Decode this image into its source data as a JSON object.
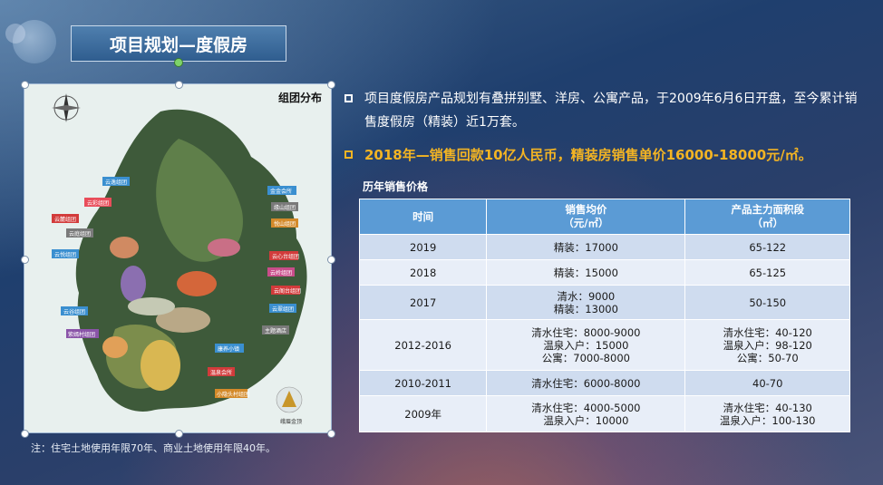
{
  "title": "项目规划—度假房",
  "map": {
    "caption": "组团分布",
    "labels": [
      "云逸组团",
      "云彩组团",
      "云庭组团",
      "云麓组团",
      "云悦组团",
      "云谷组团",
      "紫嫣村组团",
      "金金会所",
      "缘山组团",
      "悦山组团",
      "云心台组团",
      "云岭组团",
      "云阁台组团",
      "云翠组团",
      "主题酒店",
      "康养小镇",
      "温泉会所",
      "小隐头村组团",
      "峨眉金顶"
    ]
  },
  "note": "注：住宅土地使用年限70年、商业土地使用年限40年。",
  "bullets": [
    "项目度假房产品规划有叠拼别墅、洋房、公寓产品，于2009年6月6日开盘，至今累计销售度假房（精装）近1万套。",
    "2018年—销售回款10亿人民币，精装房销售单价16000-18000元/㎡。"
  ],
  "table": {
    "title": "历年销售价格",
    "headers": [
      [
        "时间"
      ],
      [
        "销售均价",
        "（元/㎡）"
      ],
      [
        "产品主力面积段",
        "（㎡）"
      ]
    ],
    "rows": [
      {
        "year": "2019",
        "price": [
          "精装：17000"
        ],
        "area": [
          "65-122"
        ]
      },
      {
        "year": "2018",
        "price": [
          "精装：15000"
        ],
        "area": [
          "65-125"
        ]
      },
      {
        "year": "2017",
        "price": [
          "清水：9000",
          "精装：13000"
        ],
        "area": [
          "50-150"
        ]
      },
      {
        "year": "2012-2016",
        "price": [
          "清水住宅：8000-9000",
          "温泉入户：15000",
          "公寓：7000-8000"
        ],
        "area": [
          "清水住宅：40-120",
          "温泉入户：98-120",
          "公寓：50-70"
        ]
      },
      {
        "year": "2010-2011",
        "price": [
          "清水住宅：6000-8000"
        ],
        "area": [
          "40-70"
        ]
      },
      {
        "year": "2009年",
        "price": [
          "清水住宅：4000-5000",
          "温泉入户：10000"
        ],
        "area": [
          "清水住宅：40-130",
          "温泉入户：100-130"
        ]
      }
    ]
  },
  "colors": {
    "header_blue": "#5b9bd5",
    "highlight_orange": "#f3b423",
    "title_blue": "#3f6fa0"
  }
}
